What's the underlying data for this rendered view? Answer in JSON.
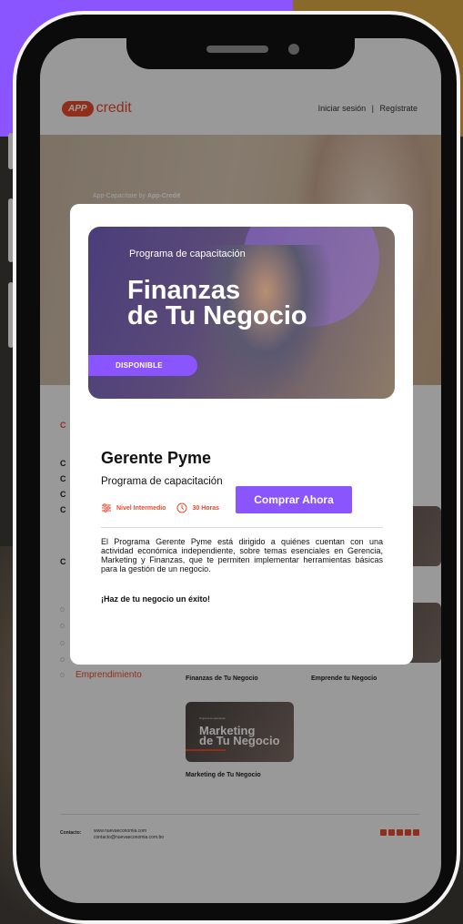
{
  "site": {
    "logo_badge": "APP",
    "logo_text": "credit",
    "login": "Iniciar sesión",
    "separator": "|",
    "register": "Regístrate",
    "hero_crumb_prefix": "App-Capacítate by ",
    "hero_crumb_brand": "App-Credit"
  },
  "menu": {
    "heading": "C",
    "rows": [
      "C",
      "C",
      "C",
      "C"
    ],
    "section": "C",
    "active_category": "Emprendimiento"
  },
  "courses": {
    "items": [
      {
        "caption": "Finanzas de Tu Negocio"
      },
      {
        "caption": "Emprende tu Negocio"
      },
      {
        "caption": "Marketing de Tu Negocio",
        "thumb_sub": "Programa de capacitación",
        "thumb_title_1": "Marketing",
        "thumb_title_2": "de Tu Negocio"
      }
    ]
  },
  "footer": {
    "label": "Contacto:",
    "email_1": "www.nuevaeconomia.com",
    "email_2": "contacto@nuevaeconomia.com.bo",
    "social_icons": [
      "facebook-icon",
      "linkedin-icon",
      "youtube-icon",
      "instagram-icon",
      "twitter-icon"
    ]
  },
  "modal": {
    "banner_subtitle": "Programa de capacitación",
    "banner_title_1": "Finanzas",
    "banner_title_2": "de Tu Negocio",
    "badge": "DISPONIBLE",
    "title": "Gerente Pyme",
    "subtitle": "Programa de capacitación",
    "level": "Nivel Intermedio",
    "duration": "30 Horas",
    "description": "El Programa Gerente Pyme está dirigido a quiénes cuentan con una actividad económica independiente, sobre temas esenciales en Gerencia, Marketing y Finanzas, que te permiten implementar herramientas básicas para la gestión de un negocio.",
    "tagline": "¡Haz de tu negocio un éxito!",
    "buy_button": "Comprar Ahora"
  },
  "colors": {
    "accent_purple": "#8a55ff",
    "brand_orange": "#e84a2d"
  }
}
